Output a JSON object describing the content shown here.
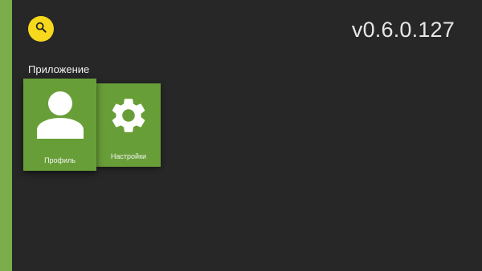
{
  "app": {
    "version": "v0.6.0.127"
  },
  "colors": {
    "background": "#272727",
    "accent_strip": "#7bad4a",
    "search_button": "#f6d81d",
    "tile": "#689e37"
  },
  "header": {
    "search_icon": "search-icon"
  },
  "section": {
    "title": "Приложение",
    "tiles": [
      {
        "label": "Профиль",
        "icon": "user-icon",
        "focused": true
      },
      {
        "label": "Настройки",
        "icon": "gear-icon",
        "focused": false
      }
    ]
  }
}
